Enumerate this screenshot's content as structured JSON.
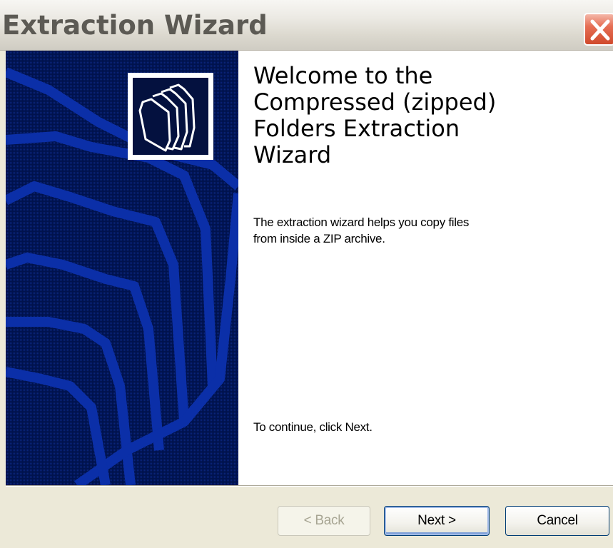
{
  "window": {
    "title": "Extraction Wizard"
  },
  "content": {
    "heading_lines": [
      "Welcome to the",
      "Compressed (zipped)",
      "Folders Extraction",
      "Wizard"
    ],
    "description_lines": [
      "The extraction wizard helps you copy files",
      "from inside a ZIP archive."
    ],
    "instruction": "To continue, click Next."
  },
  "buttons": {
    "back_label": "< Back",
    "next_label": "Next >",
    "cancel_label": "Cancel"
  },
  "colors": {
    "left_panel": "#001a6b",
    "stripe": "#0b2fa8",
    "close_button": "#e66f55",
    "dialog_bg": "#ece9d8"
  },
  "icons": {
    "close": "close-icon",
    "wizard": "folders-icon"
  }
}
